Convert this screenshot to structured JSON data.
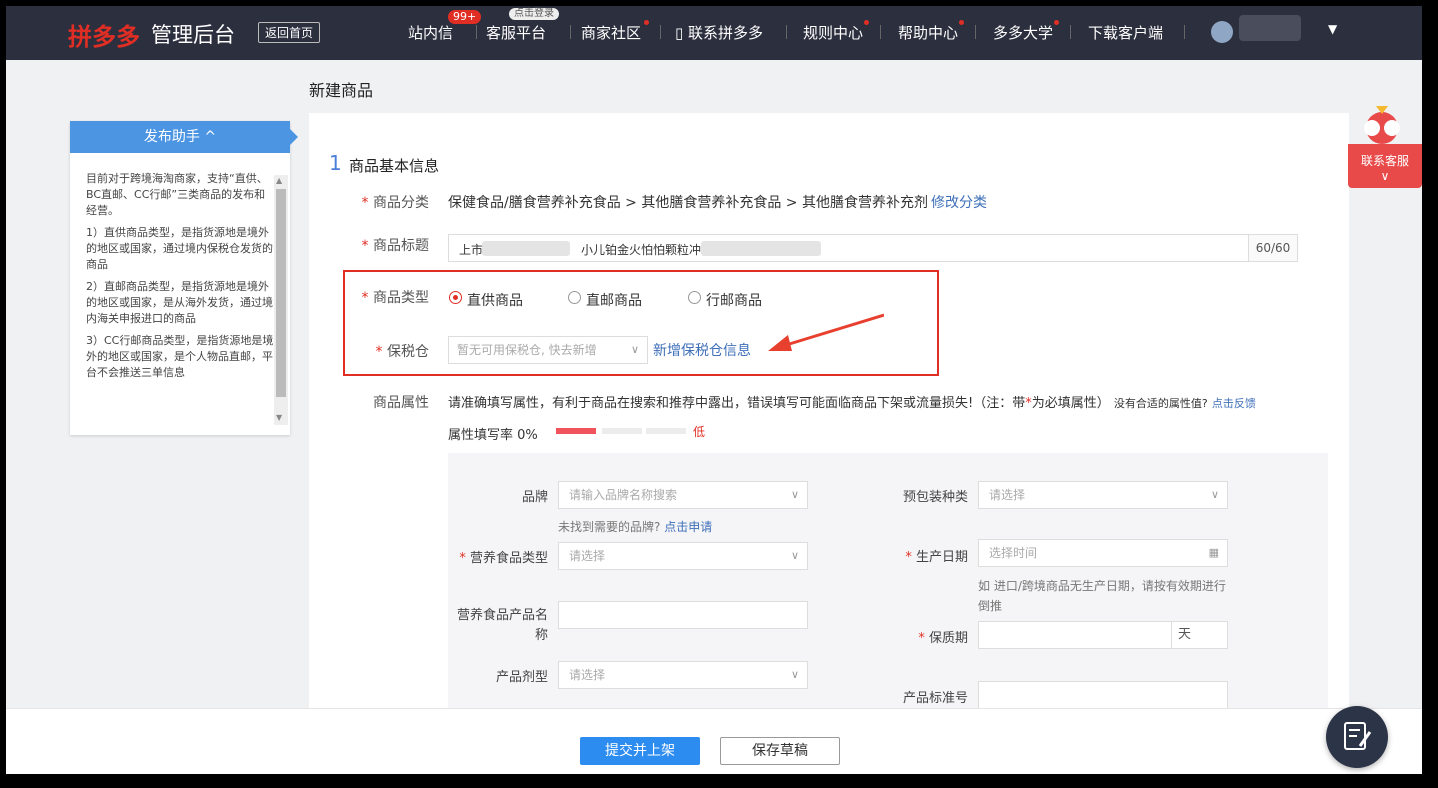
{
  "header": {
    "logo": "拼多多",
    "logo_sub": "管理后台",
    "back_home": "返回首页",
    "nav": [
      {
        "label": "站内信",
        "badge": "99+"
      },
      {
        "label": "客服平台",
        "badge": "点击登录"
      },
      {
        "label": "商家社区"
      },
      {
        "label": "联系拼多多"
      },
      {
        "label": "规则中心"
      },
      {
        "label": "帮助中心"
      },
      {
        "label": "多多大学"
      },
      {
        "label": "下载客户端"
      }
    ]
  },
  "page_title": "新建商品",
  "helper": {
    "title": "发布助手 ^",
    "intro": "目前对于跨境海淘商家，支持“直供、BC直邮、CC行邮”三类商品的发布和经营。",
    "items": [
      "1）直供商品类型，是指货源地是境外的地区或国家，通过境内保税仓发货的商品",
      "2）直邮商品类型，是指货源地是境外的地区或国家，是从海外发货，通过境内海关申报进口的商品",
      "3）CC行邮商品类型，是指货源地是境外的地区或国家，是个人物品直邮，平台不会推送三单信息"
    ]
  },
  "section": {
    "num": "1",
    "title": "商品基本信息"
  },
  "form": {
    "category_label": "商品分类",
    "category_path": "保健食品/膳食营养补充食品 > 其他膳食营养补充食品 > 其他膳食营养补充剂",
    "category_edit": "修改分类",
    "title_label": "商品标题",
    "title_value_a": "上市",
    "title_value_b": "小儿铂金火怕怕颗粒冲剂",
    "title_count": "60/60",
    "type_label": "商品类型",
    "type_options": [
      "直供商品",
      "直邮商品",
      "行邮商品"
    ],
    "warehouse_label": "保税仓",
    "warehouse_placeholder": "暂无可用保税仓, 快去新增",
    "warehouse_add": "新增保税仓信息",
    "attr_label": "商品属性",
    "attr_desc_a": "请准确填写属性，有利于商品在搜索和推荐中露出，错误填写可能面临商品下架或流量损失!（注：带",
    "attr_desc_star": "*",
    "attr_desc_b": "为必填属性）",
    "attr_desc_c": "没有合适的属性值?",
    "attr_feedback": "点击反馈",
    "attr_rate": "属性填写率 0%",
    "attr_rate_level": "低"
  },
  "attrs": {
    "brand_label": "品牌",
    "brand_placeholder": "请输入品牌名称搜索",
    "brand_note": "未找到需要的品牌?",
    "brand_note_link": "点击申请",
    "food_type_label": "营养食品类型",
    "food_type_placeholder": "请选择",
    "food_name_label": "营养食品产品名称",
    "dosage_label": "产品剂型",
    "dosage_placeholder": "请选择",
    "pack_label": "预包装种类",
    "pack_placeholder": "请选择",
    "prod_date_label": "生产日期",
    "prod_date_placeholder": "选择时间",
    "prod_date_note": "如 进口/跨境商品无生产日期，请按有效期进行倒推",
    "shelf_life_label": "保质期",
    "shelf_life_unit": "天",
    "standard_label": "产品标准号"
  },
  "footer": {
    "submit": "提交并上架",
    "draft": "保存草稿"
  },
  "cs": {
    "label": "联系客服"
  }
}
